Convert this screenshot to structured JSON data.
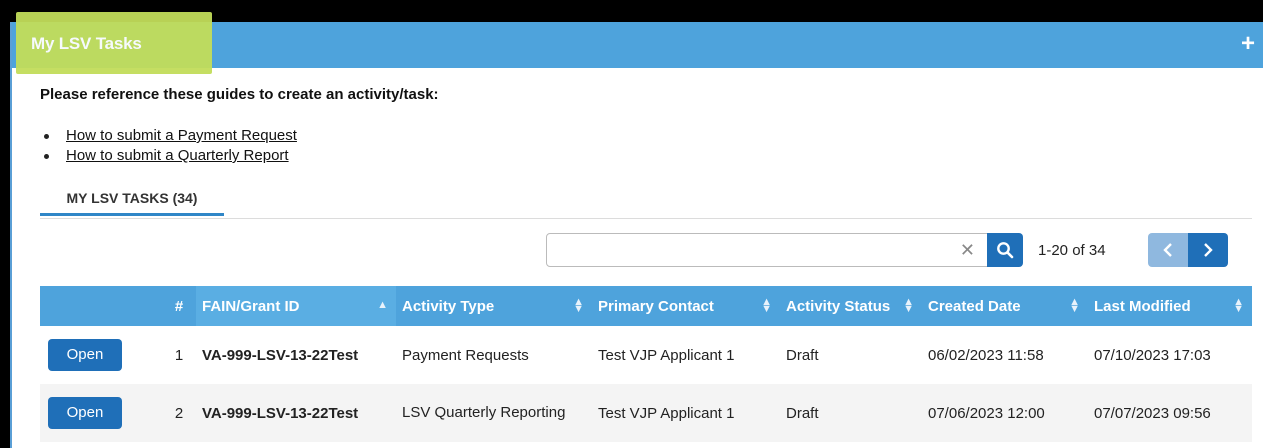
{
  "panel": {
    "title": "My LSV Tasks",
    "add_icon": "plus-icon"
  },
  "guides": {
    "heading": "Please reference these guides to create an activity/task:",
    "links": [
      {
        "label": "How to submit a Payment Request"
      },
      {
        "label": "How to submit a Quarterly Report"
      }
    ]
  },
  "tabs": [
    {
      "label": "MY LSV TASKS (34)",
      "active": true
    }
  ],
  "search": {
    "value": "",
    "placeholder": "",
    "clear_icon": "clear-icon",
    "search_icon": "search-icon"
  },
  "pager": {
    "range_text": "1-20 of 34",
    "prev_icon": "chevron-left-icon",
    "next_icon": "chevron-right-icon"
  },
  "table": {
    "columns": [
      {
        "label": ""
      },
      {
        "label": "#"
      },
      {
        "label": "FAIN/Grant ID"
      },
      {
        "label": "Activity Type"
      },
      {
        "label": "Primary Contact"
      },
      {
        "label": "Activity Status"
      },
      {
        "label": "Created Date"
      },
      {
        "label": "Last Modified"
      }
    ],
    "sorted_column": "FAIN/Grant ID",
    "rows": [
      {
        "action": "Open",
        "num": "1",
        "grant_id": "VA-999-LSV-13-22Test",
        "activity_type": "Payment Requests",
        "primary_contact": "Test VJP Applicant 1",
        "status": "Draft",
        "created": "06/02/2023 11:58",
        "modified": "07/10/2023 17:03"
      },
      {
        "action": "Open",
        "num": "2",
        "grant_id": "VA-999-LSV-13-22Test",
        "activity_type": "LSV Quarterly Reporting",
        "primary_contact": "Test VJP Applicant 1",
        "status": "Draft",
        "created": "07/06/2023 12:00",
        "modified": "07/07/2023 09:56"
      }
    ]
  },
  "colors": {
    "header_blue": "#4ea3dc",
    "button_blue": "#1f6fb8",
    "highlight": "#c2dd5a"
  }
}
